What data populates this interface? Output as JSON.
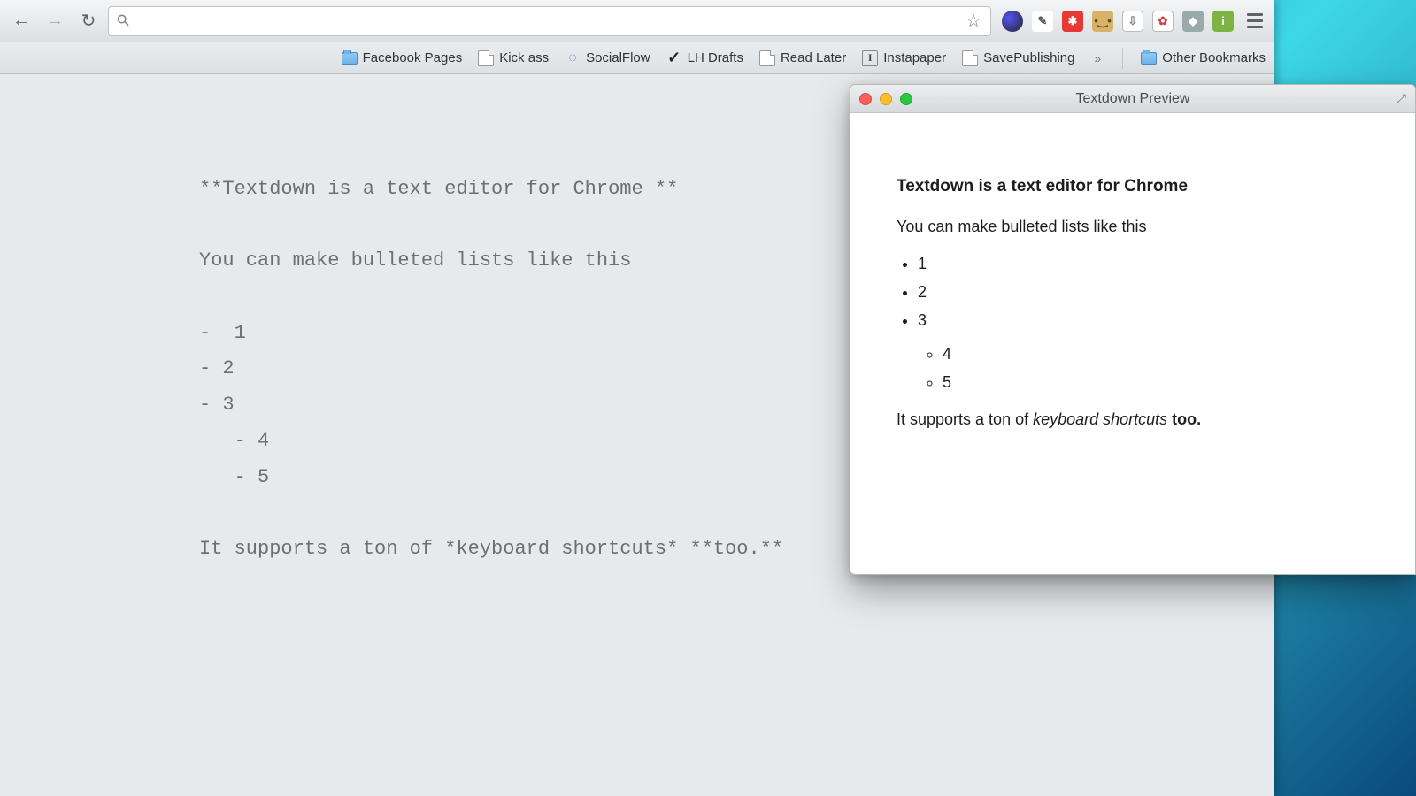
{
  "bookmarks": [
    {
      "label": "Facebook Pages",
      "icon": "folder"
    },
    {
      "label": "Kick ass",
      "icon": "page"
    },
    {
      "label": "SocialFlow",
      "icon": "spin"
    },
    {
      "label": "LH Drafts",
      "icon": "draft"
    },
    {
      "label": "Read Later",
      "icon": "page"
    },
    {
      "label": "Instapaper",
      "icon": "insta"
    },
    {
      "label": "SavePublishing",
      "icon": "page"
    }
  ],
  "other_bookmarks_label": "Other Bookmarks",
  "editor": {
    "line1": "**Textdown is a text editor for Chrome **",
    "line2": "You can make bulleted lists like this",
    "b1": "-  1",
    "b2": "- 2",
    "b3": "- 3",
    "b4": "   - 4",
    "b5": "   - 5",
    "line3": "It supports a ton of *keyboard shortcuts* **too.**"
  },
  "preview": {
    "window_title": "Textdown Preview",
    "heading": "Textdown is a text editor for Chrome",
    "p1": "You can make bulleted lists like this",
    "list": {
      "a": "1",
      "b": "2",
      "c": "3",
      "d": "4",
      "e": "5"
    },
    "foot_pre": "It supports a ton of ",
    "foot_em": "keyboard shortcuts",
    "foot_post": " too."
  },
  "icons": {
    "back": "←",
    "forward": "→",
    "reload": "↻",
    "search": "⚲",
    "star": "☆",
    "chevron": "»",
    "expand": "⤢"
  }
}
